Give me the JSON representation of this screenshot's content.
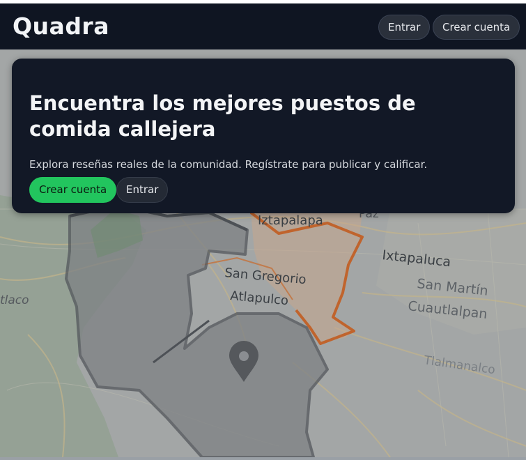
{
  "header": {
    "brand": "Quadra",
    "login_label": "Entrar",
    "signup_label": "Crear cuenta"
  },
  "hero": {
    "title": "Encuentra los mejores puestos de comida callejera",
    "subtitle": "Explora reseñas reales de la comunidad. Regístrate para publicar y calificar.",
    "primary_label": "Crear cuenta",
    "secondary_label": "Entrar"
  },
  "map": {
    "labels": [
      "Iztapalapa",
      "Ixtapaluca",
      "San Martín",
      "Cuautlalpan",
      "San Gregorio",
      "Atlapulco",
      "Tlalmanalco",
      "tlaco",
      "Paz"
    ],
    "marker_icon": "map-pin-icon"
  },
  "colors": {
    "header_bg": "#0f1522",
    "card_bg": "#121826",
    "accent": "#22c55e",
    "highlight_route": "#c0642d"
  }
}
